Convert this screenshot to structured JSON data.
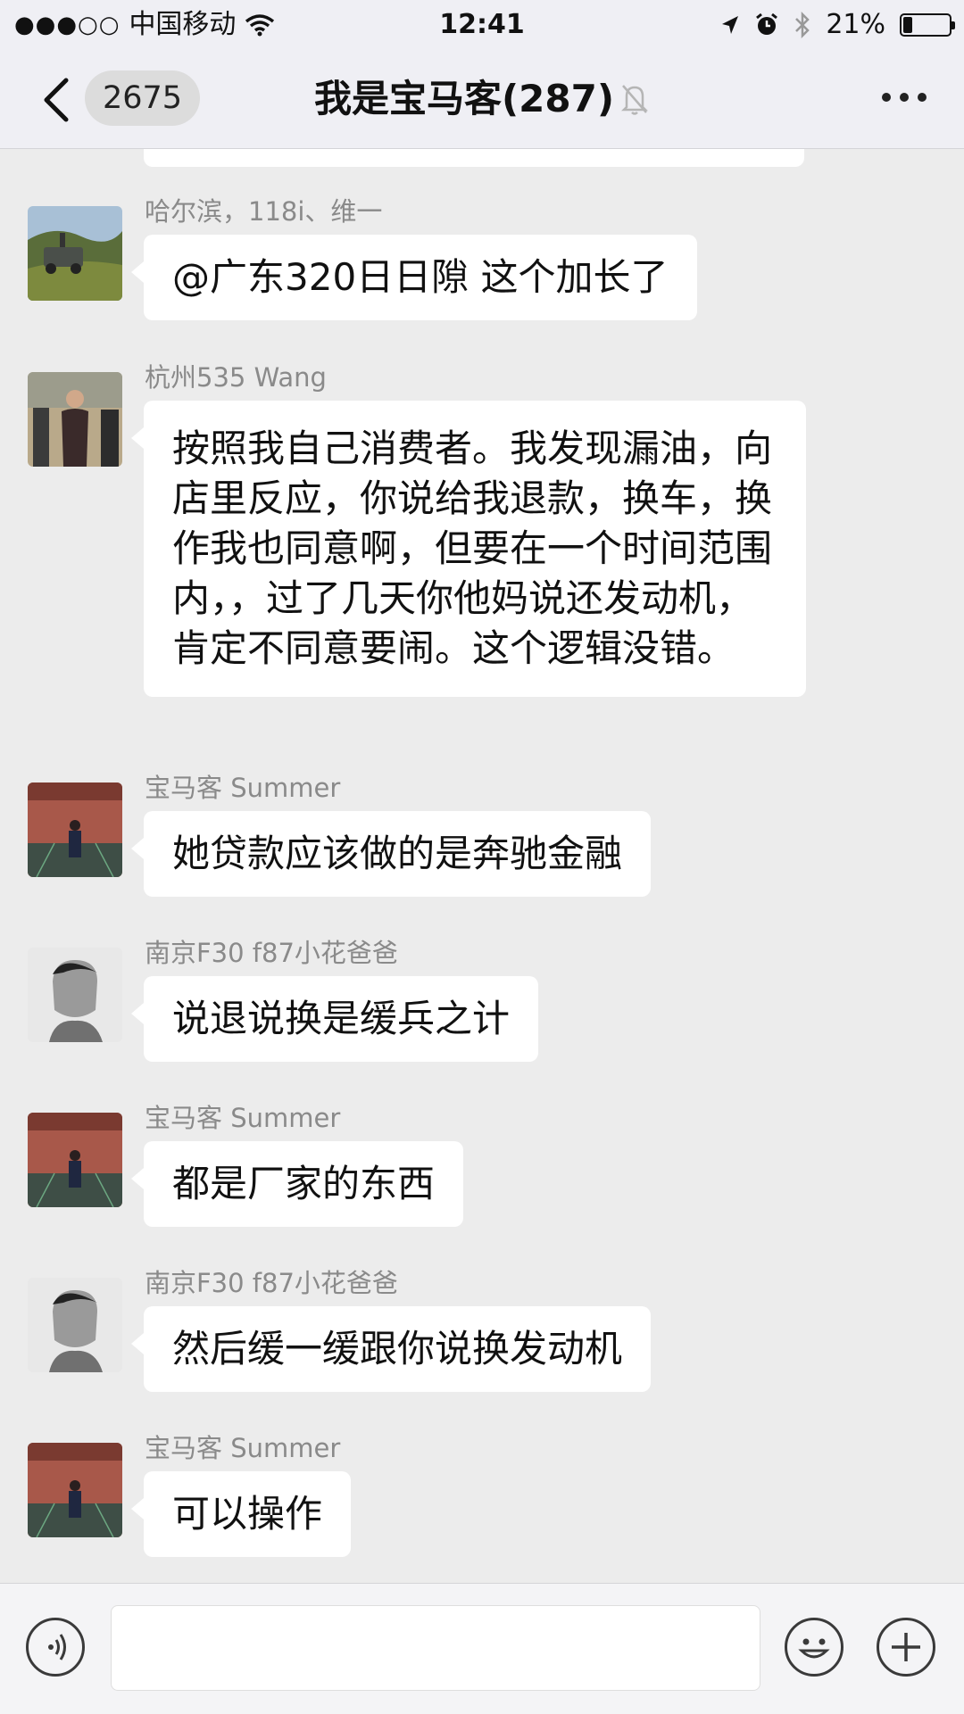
{
  "status_bar": {
    "signal": "●●●○○",
    "carrier": "中国移动",
    "time": "12:41",
    "battery": "21%"
  },
  "nav": {
    "unread_count": "2675",
    "title": "我是宝马客(287)"
  },
  "messages": [
    {
      "sender": "哈尔滨，118i、维一",
      "text": "@广东320日日隙 这个加长了",
      "avatar": "landrover-photo"
    },
    {
      "sender": "杭州535 Wang",
      "text": "按照我自己消费者。我发现漏油，向店里反应，你说给我退款，换车，换作我也同意啊，但要在一个时间范围内，，过了几天你他妈说还发动机，肯定不同意要闹。这个逻辑没错。",
      "avatar": "suited-man-photo"
    },
    {
      "sender": "宝马客 Summer",
      "text": "她贷款应该做的是奔驰金融",
      "avatar": "street-man-photo"
    },
    {
      "sender": "南京F30 f87小花爸爸",
      "text": "说退说换是缓兵之计",
      "avatar": "bw-portrait-photo"
    },
    {
      "sender": "宝马客 Summer",
      "text": "都是厂家的东西",
      "avatar": "street-man-photo"
    },
    {
      "sender": "南京F30 f87小花爸爸",
      "text": "然后缓一缓跟你说换发动机",
      "avatar": "bw-portrait-photo"
    },
    {
      "sender": "宝马客 Summer",
      "text": "可以操作",
      "avatar": "street-man-photo"
    }
  ],
  "input_bar": {
    "placeholder": ""
  },
  "colors": {
    "background": "#ececec",
    "bubble": "#ffffff",
    "bar": "#efeff4",
    "sender_text": "#8a8a8a"
  }
}
